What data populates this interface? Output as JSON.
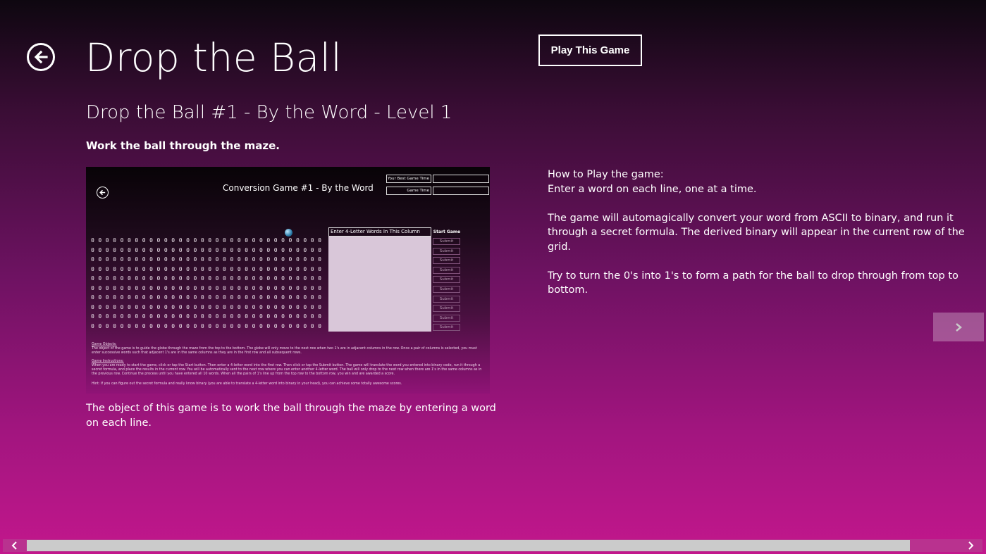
{
  "header": {
    "title": "Drop the Ball",
    "play_label": "Play This Game"
  },
  "item": {
    "subtitle": "Drop the Ball #1 - By the Word - Level 1",
    "tagline": "Work the ball through the maze.",
    "caption": "The object of this game is to work the ball through the maze by entering a word on each line."
  },
  "screenshot": {
    "title": "Conversion Game #1 - By the Word",
    "best_time_label": "Your Best Game Time",
    "game_time_label": "Game Time",
    "entry_header": "Enter 4-Letter Words In This Column",
    "start_label": "Start Game",
    "submit_label": "Submit",
    "grid_digit": "0",
    "objective_heading": "Game Objects:",
    "objective_text": "The object of the game is to guide the globe through the maze from the top to the bottom. The globe will only move to the next row when two 1's are in adjacent columns in the row. Once a pair of columns is selected, you must enter successive words such that adjacent 1's are in the same columns as they are in the first row and all subsequent rows.",
    "instructions_heading": "Game Instructions:",
    "instructions_text": "When you are ready to start the game, click or tap the Start button. Then enter a 4-letter word into the first row. Then click or tap the Submit button. The game will translate the word you entered into binary code, run it through a secret formula, and place the results in the current row. You will be automatically sent to the next row where you can enter another 4-letter word. The ball will only drop to the next row when there are 1's in the same columns as in the previous row. Continue the process until you have entered all 10 words. When all the pairs of 1's line up from the top row to the bottom row, you win and are awarded a score.",
    "hint_text": "Hint: If you can figure out the secret formula and really know binary (you are able to translate a 4-letter word into binary in your head), you can achieve some totally awesome scores."
  },
  "how_to": {
    "heading": "How to Play the game:",
    "line1": "Enter a word on each line, one at a time.",
    "para2": "The game will automagically convert your word from ASCII to binary, and run it through a secret formula.  The derived binary will appear in the current row of the grid.",
    "para3": "Try to turn the 0's into 1's to form a path for the ball to drop through from top to bottom."
  },
  "scroll": {
    "position": 0.0
  },
  "icons": {
    "back": "back-arrow-icon",
    "next": "chevron-right-icon",
    "scroll_left": "chevron-left-icon",
    "scroll_right": "chevron-right-icon"
  },
  "colors": {
    "background_top": "#0e0710",
    "background_bottom": "#c2178c",
    "scrollbar": "#b9328f",
    "scroll_thumb": "#cbcbcb"
  }
}
